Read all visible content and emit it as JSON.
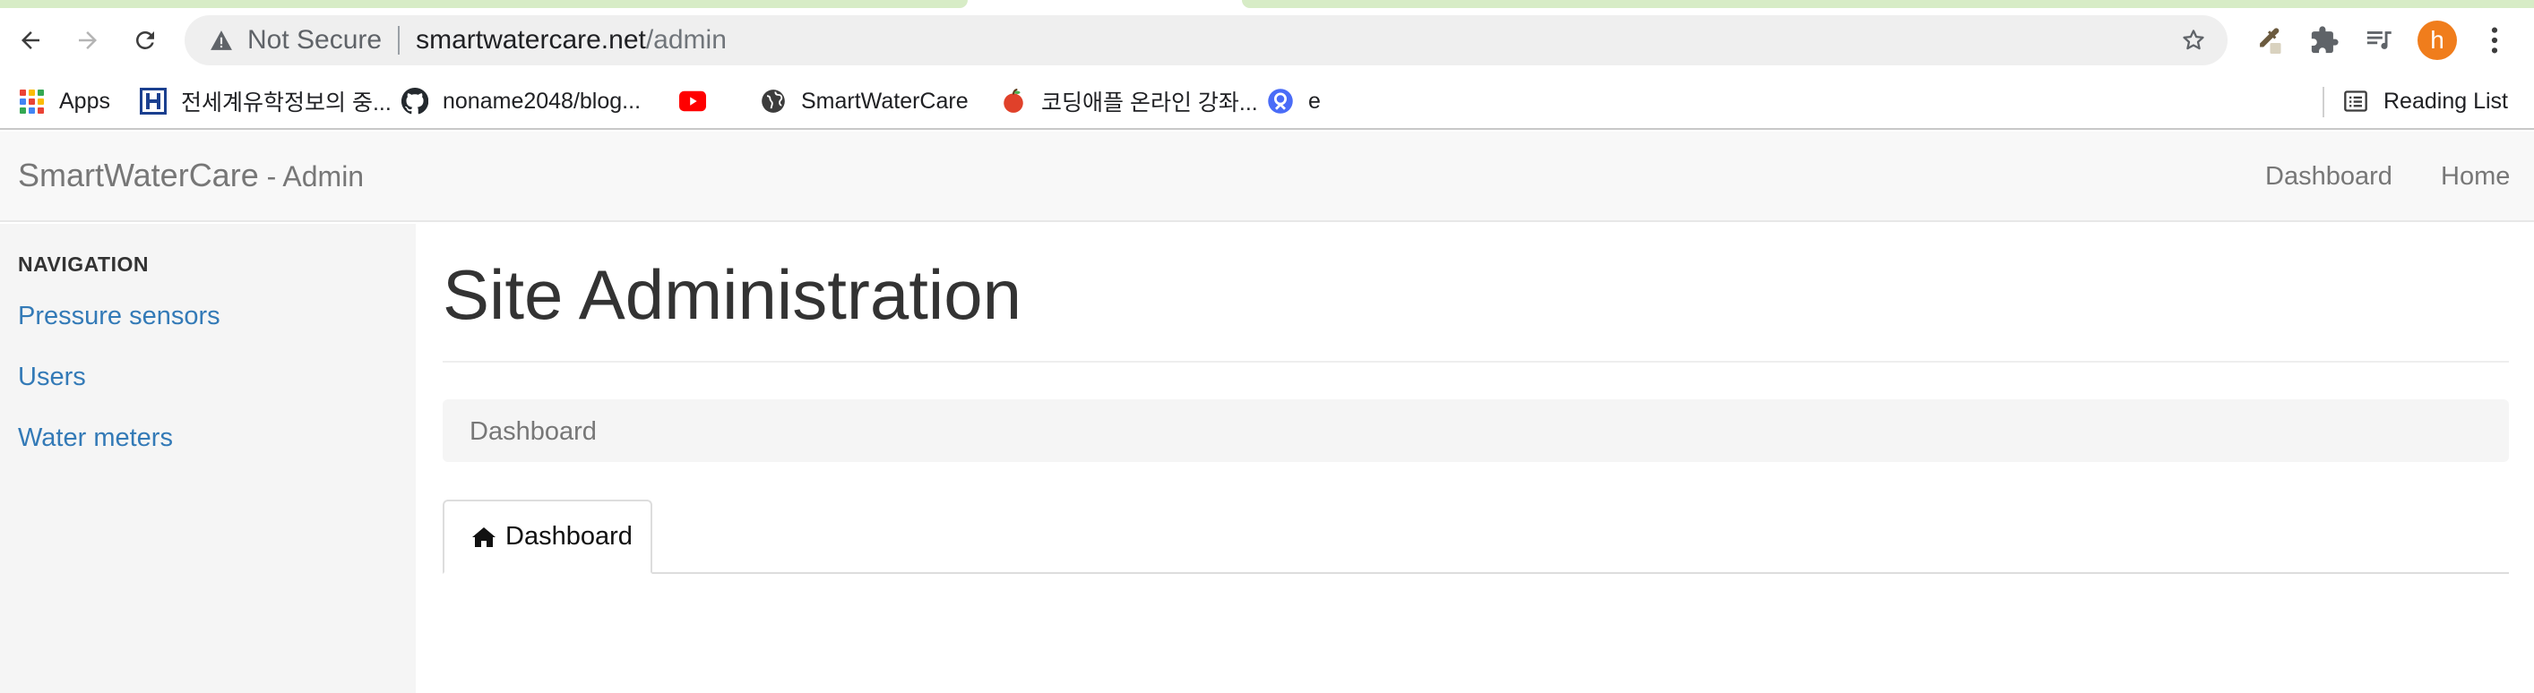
{
  "browser": {
    "security_label": "Not Secure",
    "url_host": "smartwatercare.net",
    "url_path": "/admin",
    "profile_initial": "h",
    "colors": {
      "tab_accent": "#d7ecc6",
      "profile": "#f07d1c"
    }
  },
  "bookmarks": {
    "items": [
      {
        "label": "Apps",
        "icon": "apps-grid-icon"
      },
      {
        "label": "전세계유학정보의 중...",
        "icon": "h-logo-icon"
      },
      {
        "label": "noname2048/blog...",
        "icon": "github-icon"
      },
      {
        "label": "",
        "icon": "youtube-icon"
      },
      {
        "label": "SmartWaterCare",
        "icon": "globe-icon"
      },
      {
        "label": "코딩애플 온라인 강좌...",
        "icon": "apple-icon"
      },
      {
        "label": "e",
        "icon": "e-app-icon"
      }
    ],
    "reading_list": "Reading List"
  },
  "navbar": {
    "brand": "SmartWaterCare",
    "brand_suffix": " - Admin",
    "links": [
      "Dashboard",
      "Home"
    ]
  },
  "sidebar": {
    "header": "NAVIGATION",
    "items": [
      {
        "label": "Pressure sensors"
      },
      {
        "label": "Users"
      },
      {
        "label": "Water meters"
      }
    ],
    "colors": {
      "link": "#337ab7"
    }
  },
  "main": {
    "title": "Site Administration",
    "breadcrumb": "Dashboard",
    "tabs": [
      {
        "label": "Dashboard",
        "icon": "home-icon",
        "active": true
      }
    ]
  }
}
